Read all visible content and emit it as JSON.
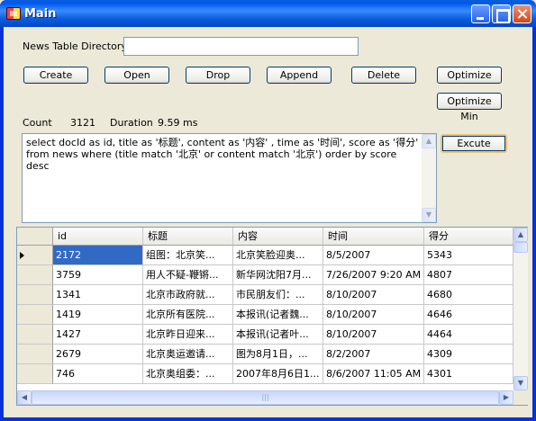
{
  "window": {
    "title": "Main"
  },
  "form": {
    "directory_label": "News Table Directory",
    "directory_value": "",
    "buttons": {
      "create": "Create",
      "open": "Open",
      "drop": "Drop",
      "append": "Append",
      "delete": "Delete",
      "optimize": "Optimize",
      "optimize_min": "Optimize Min",
      "excute": "Excute"
    },
    "stats": {
      "count_label": "Count",
      "count_value": "3121",
      "duration_label": "Duration",
      "duration_value": "9.59 ms"
    },
    "query": "select docId as id, title as '标题', content as '内容' , time as '时间', score as '得分' from news where (title match '北京' or content match '北京')  order by score desc"
  },
  "table": {
    "columns": [
      "id",
      "标题",
      "内容",
      "时间",
      "得分"
    ],
    "rows": [
      [
        "2172",
        "组图：北京笑...",
        "北京笑脸迎奥...",
        "8/5/2007",
        "5343"
      ],
      [
        "3759",
        "用人不疑-鞭锵...",
        "新华网沈阳7月...",
        "7/26/2007 9:20 AM",
        "4807"
      ],
      [
        "1341",
        "北京市政府就...",
        "市民朋友们：...",
        "8/10/2007",
        "4680"
      ],
      [
        "1419",
        "北京所有医院...",
        "本报讯(记者魏...",
        "8/10/2007",
        "4646"
      ],
      [
        "1427",
        "北京昨日迎来...",
        "本报讯(记者叶...",
        "8/10/2007",
        "4464"
      ],
      [
        "2679",
        "北京奥运邀请...",
        "图为8月1日，...",
        "8/2/2007",
        "4309"
      ],
      [
        "746",
        "北京奥组委：...",
        "2007年8月6日1...",
        "8/6/2007 11:05 AM",
        "4301"
      ]
    ],
    "selected_row": 0
  },
  "colors": {
    "titlebar": "#0058ee",
    "selection": "#316ac5",
    "face": "#ece9d8"
  }
}
